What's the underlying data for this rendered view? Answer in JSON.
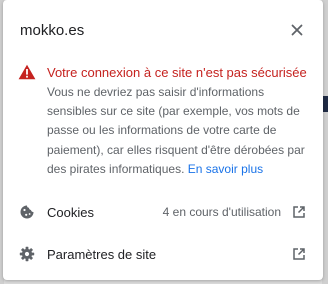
{
  "site": {
    "name": "mokko.es"
  },
  "warning": {
    "title": "Votre connexion à ce site n'est pas sécurisée",
    "body": "Vous ne devriez pas saisir d'informations sensibles sur ce site (par exemple, vos mots de passe ou les informations de votre carte de paiement), car elles risquent d'être dérobées par des pirates informatiques. ",
    "learn_more": "En savoir plus",
    "color": "#c5221f"
  },
  "rows": {
    "cookies": {
      "label": "Cookies",
      "value": "4 en cours d'utilisation",
      "icon": "cookie-icon"
    },
    "site_settings": {
      "label": "Paramètres de site",
      "icon": "gear-icon"
    }
  },
  "colors": {
    "link": "#1a73e8",
    "text": "#202124",
    "secondary_text": "#5f6368"
  }
}
